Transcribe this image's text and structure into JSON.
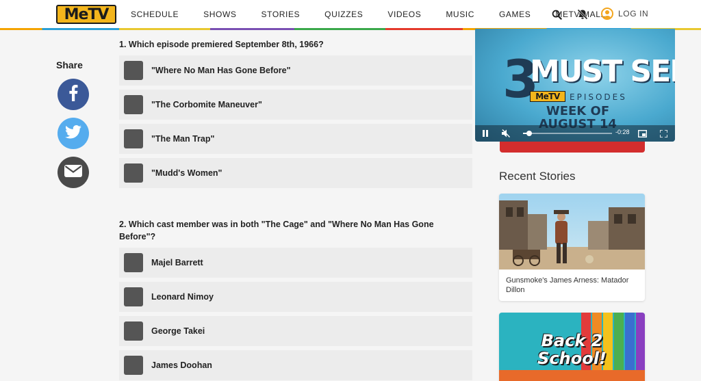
{
  "header": {
    "logo_text": "MeTV",
    "nav": [
      "SCHEDULE",
      "SHOWS",
      "STORIES",
      "QUIZZES",
      "VIDEOS",
      "MUSIC",
      "GAMES",
      "METV MALL"
    ],
    "search_icon": "search-icon",
    "notifications_icon": "bell-off-icon",
    "login_label": "LOG IN"
  },
  "share": {
    "title": "Share",
    "buttons": [
      {
        "icon": "facebook-icon",
        "color": "#3b5998"
      },
      {
        "icon": "twitter-icon",
        "color": "#55acee"
      },
      {
        "icon": "email-icon",
        "color": "#4a4a4a"
      }
    ]
  },
  "quiz": {
    "questions": [
      {
        "text": "1. Which episode premiered September 8th, 1966?",
        "answers": [
          "\"Where No Man Has Gone Before\"",
          "\"The Corbomite Maneuver\"",
          "\"The Man Trap\"",
          "\"Mudd's Women\""
        ]
      },
      {
        "text": "2. Which cast member was in both \"The Cage\" and \"Where No Man Has Gone Before\"?",
        "answers": [
          "Majel Barrett",
          "Leonard Nimoy",
          "George Takei",
          "James Doohan"
        ]
      }
    ]
  },
  "video": {
    "number": "3",
    "headline": "MUST SEE",
    "brand": "MeTV",
    "subhead": "EPISODES",
    "week_line1": "WEEK OF",
    "week_line2": "AUGUST 14",
    "time_remaining": "-0:28",
    "progress_fraction": 0.07
  },
  "recent": {
    "title": "Recent Stories",
    "stories": [
      {
        "caption": "Gunsmoke's James Arness: Matador Dillon"
      },
      {
        "image_text": "Back 2\nSchool!"
      }
    ]
  }
}
